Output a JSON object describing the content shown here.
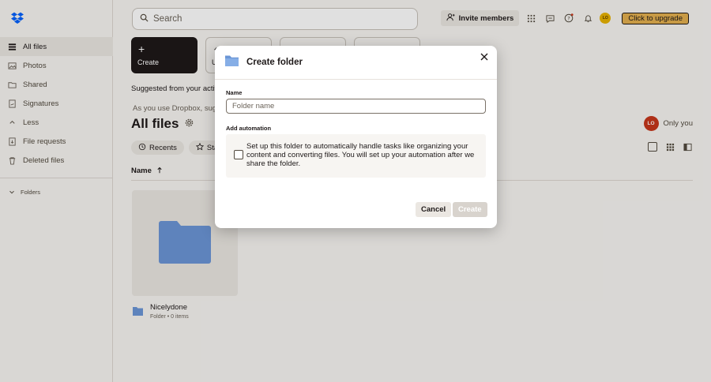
{
  "sidebar": {
    "items": [
      {
        "label": "All files"
      },
      {
        "label": "Photos"
      },
      {
        "label": "Shared"
      },
      {
        "label": "Signatures"
      },
      {
        "label": "Less"
      },
      {
        "label": "File requests"
      },
      {
        "label": "Deleted files"
      }
    ],
    "folders_label": "Folders"
  },
  "search": {
    "placeholder": "Search"
  },
  "topbar": {
    "invite_label": "Invite members",
    "avatar_initials": "LO",
    "upgrade_label": "Click to upgrade"
  },
  "tiles": {
    "create_label": "Create",
    "upload_partial": "U"
  },
  "suggested_text": "Suggested from your activ",
  "as_you_text": "As you use Dropbox, sugge",
  "page": {
    "title": "All files",
    "owner_initials": "LO",
    "owner_text": "Only you"
  },
  "chips": {
    "recents": "Recents",
    "starred_partial": "Star"
  },
  "table": {
    "name_header": "Name"
  },
  "file": {
    "name": "Nicelydone",
    "meta": "Folder • 0 items"
  },
  "modal": {
    "title": "Create folder",
    "name_label": "Name",
    "name_placeholder": "Folder name",
    "automation_label": "Add automation",
    "automation_text": "Set up this folder to automatically handle tasks like organizing your content and converting files. You will set up your automation after we share the folder.",
    "cancel_label": "Cancel",
    "create_label": "Create"
  },
  "colors": {
    "folder_blue": "#6b96d6",
    "upgrade": "#e4b04f",
    "dark": "#1e1919"
  }
}
